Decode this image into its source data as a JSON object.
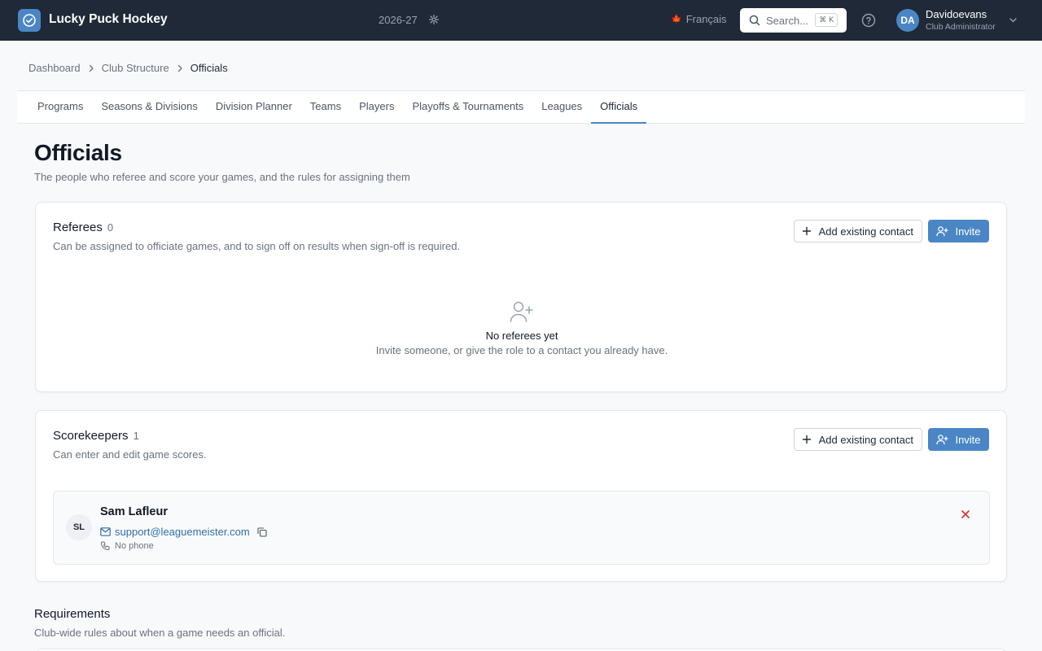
{
  "header": {
    "club_name": "Lucky Puck Hockey",
    "season": "2026-27",
    "language": "Français",
    "search_placeholder": "Search...",
    "search_shortcut": "⌘ K",
    "user": {
      "initials": "DA",
      "name": "Davidoevans",
      "role": "Club Administrator"
    },
    "colors": {
      "bar": "#1f2937",
      "accent": "#4a86c5"
    }
  },
  "breadcrumb": [
    "Dashboard",
    "Club Structure",
    "Officials"
  ],
  "tabs": [
    {
      "label": "Programs"
    },
    {
      "label": "Seasons & Divisions"
    },
    {
      "label": "Division Planner"
    },
    {
      "label": "Teams"
    },
    {
      "label": "Players"
    },
    {
      "label": "Playoffs & Tournaments"
    },
    {
      "label": "Leagues"
    },
    {
      "label": "Officials",
      "active": true
    }
  ],
  "page": {
    "title": "Officials",
    "subtitle": "The people who referee and score your games, and the rules for assigning them"
  },
  "referees": {
    "title": "Referees",
    "count": "0",
    "description": "Can be assigned to officiate games, and to sign off on results when sign-off is required.",
    "add_label": "Add existing contact",
    "invite_label": "Invite",
    "empty_title": "No referees yet",
    "empty_desc": "Invite someone, or give the role to a contact you already have."
  },
  "scorekeepers": {
    "title": "Scorekeepers",
    "count": "1",
    "description": "Can enter and edit game scores.",
    "add_label": "Add existing contact",
    "invite_label": "Invite",
    "contacts": [
      {
        "initials": "SL",
        "name": "Sam Lafleur",
        "email": "support@leaguemeister.com",
        "phone": "No phone"
      }
    ]
  },
  "requirements": {
    "title": "Requirements",
    "subtitle": "Club-wide rules about when a game needs an official."
  }
}
